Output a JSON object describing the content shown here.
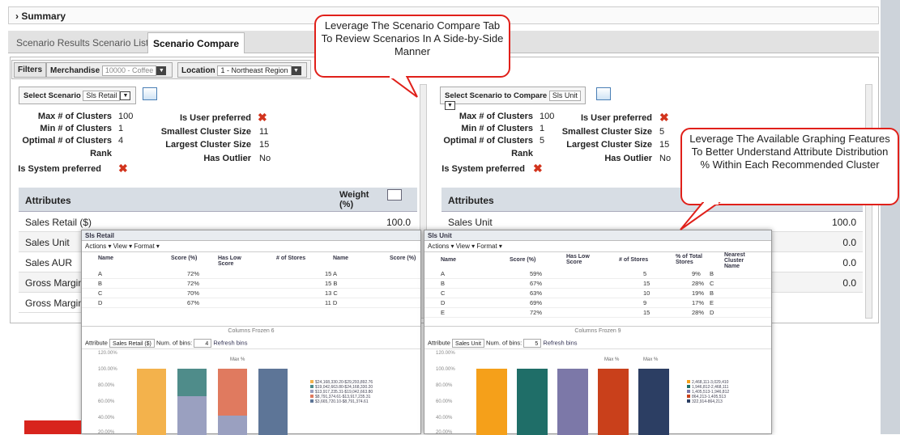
{
  "summary_label": "Summary",
  "tabs": [
    "Scenario Results",
    "Scenario List",
    "Scenario Compare"
  ],
  "filters": {
    "label": "Filters",
    "merchandise_label": "Merchandise",
    "merchandise_value": "10000 - Coffee",
    "location_label": "Location",
    "location_value": "1 - Northeast Region"
  },
  "left": {
    "select_label": "Select Scenario",
    "select_value": "Sls Retail",
    "max_label": "Max # of Clusters",
    "max_value": "100",
    "min_label": "Min # of Clusters",
    "min_value": "1",
    "opt_label": "Optimal # of Clusters",
    "opt_value": "4",
    "rank_label": "Rank",
    "sys_label": "Is System preferred",
    "user_label": "Is User preferred",
    "small_label": "Smallest Cluster Size",
    "small_value": "11",
    "large_label": "Largest Cluster Size",
    "large_value": "15",
    "outlier_label": "Has Outlier",
    "outlier_value": "No",
    "attr_header": "Attributes",
    "weight_header": "Weight (%)",
    "rows": [
      {
        "name": "Sales Retail ($)",
        "weight": "100.0"
      },
      {
        "name": "Sales Unit",
        "weight": ""
      },
      {
        "name": "Sales AUR",
        "weight": ""
      },
      {
        "name": "Gross Margin R",
        "weight": ""
      },
      {
        "name": "Gross Margin %",
        "weight": ""
      }
    ]
  },
  "right": {
    "select_label": "Select Scenario to Compare",
    "select_value": "Sls Unit",
    "max_label": "Max # of Clusters",
    "max_value": "100",
    "min_label": "Min # of Clusters",
    "min_value": "1",
    "opt_label": "Optimal # of Clusters",
    "opt_value": "5",
    "rank_label": "Rank",
    "sys_label": "Is System preferred",
    "user_label": "Is User preferred",
    "small_label": "Smallest Cluster Size",
    "small_value": "5",
    "large_label": "Largest Cluster Size",
    "large_value": "15",
    "outlier_label": "Has Outlier",
    "outlier_value": "No",
    "attr_header": "Attributes",
    "rows": [
      {
        "name": "Sales Unit",
        "weight": "100.0"
      },
      {
        "name": "",
        "weight": "0.0"
      },
      {
        "name": "",
        "weight": "0.0"
      },
      {
        "name": "",
        "weight": "0.0"
      }
    ]
  },
  "callout1": "Leverage The Scenario Compare Tab To Review Scenarios In A Side-by-Side Manner",
  "callout2": "Leverage The Available Graphing Features To Better Understand Attribute Distribution % Within Each Recommended Cluster",
  "popup_left": {
    "title": "Sls Retail",
    "toolbar": "Actions ▾   View ▾   Format ▾",
    "cols": [
      "Name",
      "Score (%)",
      "Has Low Score",
      "# of Stores",
      "Name",
      "Score (%)"
    ],
    "rows": [
      [
        "A",
        "72%",
        "",
        "",
        "15 A"
      ],
      [
        "B",
        "72%",
        "",
        "",
        "15 B"
      ],
      [
        "C",
        "70%",
        "",
        "",
        "13 C"
      ],
      [
        "D",
        "67%",
        "",
        "",
        "11 D"
      ]
    ],
    "frozen": "Columns Frozen  6",
    "attr_label": "Attribute",
    "attr_value": "Sales Retail ($)",
    "bins_label": "Num. of bins:",
    "bins_value": "4",
    "refresh": "Refresh bins",
    "yticks": [
      "120.00%",
      "100.00%",
      "80.00%",
      "60.00%",
      "40.00%",
      "20.00%"
    ],
    "ylabel": "Percent %",
    "max": "Max %",
    "legend": [
      "$24,168,330.20-$29,293,892.76",
      "$19,042,663.80-$24,168,330.20",
      "$13,917,235.31-$19,042,663.80",
      "$8,791,374.61-$13,917,235.31",
      "$3,665,720.10-$8,791,374.61"
    ]
  },
  "popup_right": {
    "title": "Sls Unit",
    "toolbar": "Actions ▾   View ▾   Format ▾",
    "cols": [
      "Name",
      "Score (%)",
      "Has Low Score",
      "# of Stores",
      "% of Total Stores",
      "Nearest Cluster Name"
    ],
    "rows": [
      [
        "A",
        "59%",
        "",
        "5",
        "9%",
        "B"
      ],
      [
        "B",
        "67%",
        "",
        "15",
        "28%",
        "C"
      ],
      [
        "C",
        "63%",
        "",
        "10",
        "19%",
        "B"
      ],
      [
        "D",
        "69%",
        "",
        "9",
        "17%",
        "E"
      ],
      [
        "E",
        "72%",
        "",
        "15",
        "28%",
        "D"
      ]
    ],
    "frozen": "Columns Frozen  9",
    "attr_label": "Attribute",
    "attr_value": "Sales Unit",
    "bins_label": "Num. of bins:",
    "bins_value": "5",
    "refresh": "Refresh bins",
    "yticks": [
      "120.00%",
      "100.00%",
      "80.00%",
      "60.00%",
      "40.00%",
      "20.00%"
    ],
    "ylabel": "Percent %",
    "max": "Max %",
    "legend": [
      "2,468,111-3,029,410",
      "1,946,812-2,468,111",
      "1,405,513-1,946,812",
      "864,213-1,405,513",
      "322,914-864,213"
    ]
  }
}
